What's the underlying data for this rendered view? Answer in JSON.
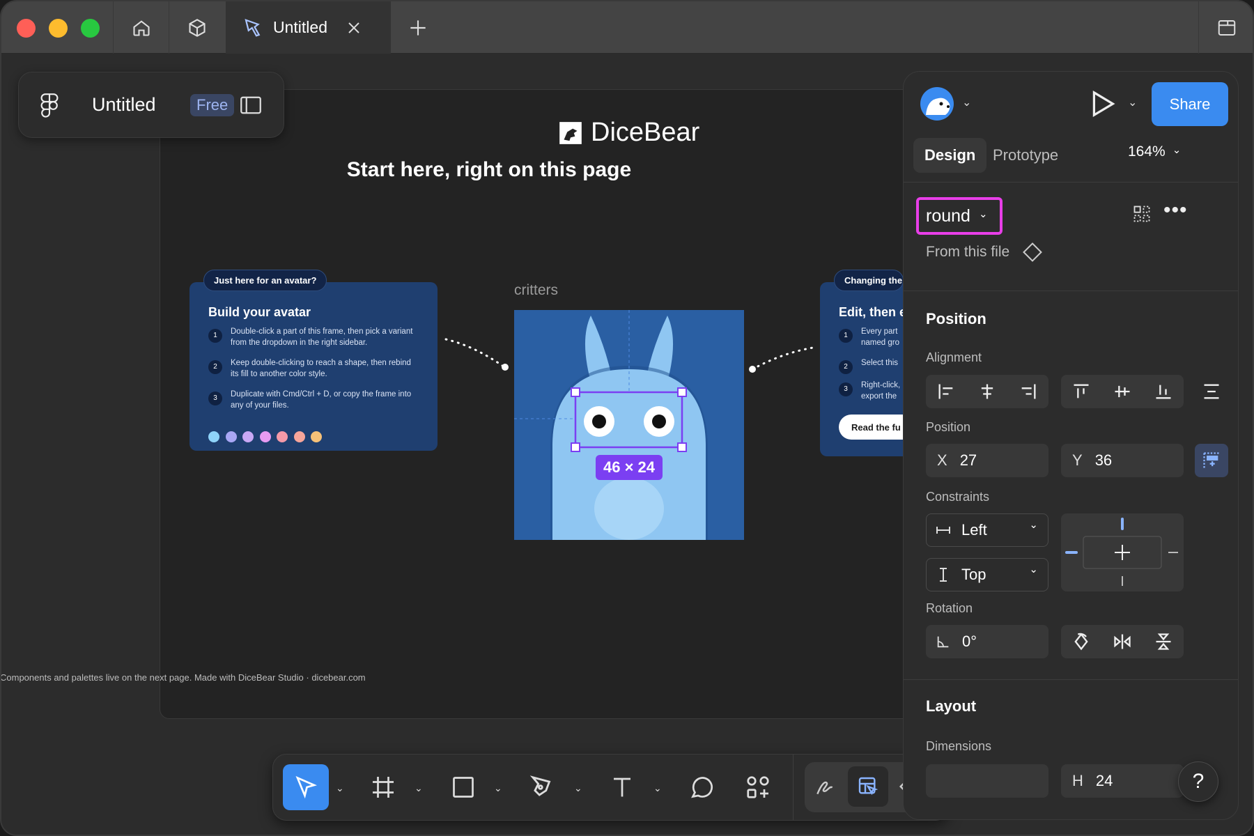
{
  "titlebar": {
    "tab_title": "Untitled",
    "traffic_colors": [
      "#ff5f57",
      "#febc2e",
      "#28c840"
    ]
  },
  "file": {
    "name": "Untitled",
    "plan_badge": "Free"
  },
  "canvas": {
    "brand": "DiceBear",
    "headline": "Start here, right on this page",
    "left_card": {
      "pill": "Just here for an avatar?",
      "title": "Build your avatar",
      "steps": [
        {
          "n": "1",
          "text": "Double-click a part of this frame, then pick a variant from the dropdown in the right sidebar."
        },
        {
          "n": "2",
          "text": "Keep double-clicking to reach a shape, then rebind its fill to another color style."
        },
        {
          "n": "3",
          "text": "Duplicate with Cmd/Ctrl + D, or copy the frame into any of your files."
        }
      ],
      "palette": [
        "#8fd3f9",
        "#a9a7f5",
        "#c9a8f5",
        "#e79bf2",
        "#f49aa8",
        "#f7a59a",
        "#f6c178"
      ]
    },
    "right_card": {
      "pill": "Changing the",
      "title": "Edit, then e",
      "steps": [
        {
          "n": "1",
          "text": "Every part named gro"
        },
        {
          "n": "2",
          "text": "Select this"
        },
        {
          "n": "3",
          "text": "Right-click, export the"
        }
      ],
      "button": "Read the fu"
    },
    "frame_label": "critters",
    "selection_size": "46 × 24",
    "footer_note": "Components and palettes live on the next page. Made with DiceBear Studio · dicebear.com"
  },
  "panel": {
    "share_label": "Share",
    "tabs": [
      "Design",
      "Prototype"
    ],
    "zoom": "164%",
    "variant": "round",
    "variant_source": "From this file",
    "position_title": "Position",
    "alignment_label": "Alignment",
    "position_label": "Position",
    "x_label": "X",
    "x_value": "27",
    "y_label": "Y",
    "y_value": "36",
    "constraints_label": "Constraints",
    "constraint_h": "Left",
    "constraint_v": "Top",
    "rotation_label": "Rotation",
    "rotation_value": "0°",
    "layout_title": "Layout",
    "dimensions_label": "Dimensions",
    "h_label": "H",
    "h_value": "24",
    "help": "?"
  },
  "colors": {
    "accent": "#3a8bf0",
    "highlight": "#e83ee8",
    "selection": "#7b3ff2"
  }
}
